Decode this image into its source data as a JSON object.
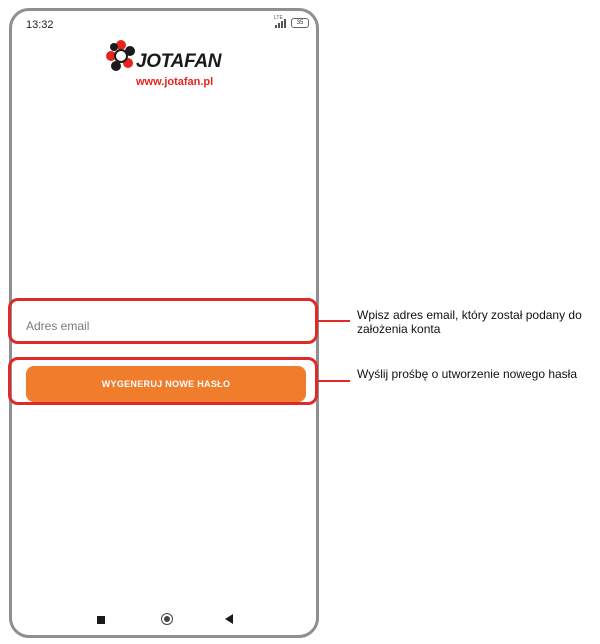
{
  "status_bar": {
    "time": "13:32",
    "network": "LTE",
    "battery": "35"
  },
  "logo": {
    "brand": "JOTAFAN",
    "url": "www.jotafan.pl"
  },
  "email": {
    "placeholder": "Adres email",
    "value": ""
  },
  "submit": {
    "label": "WYGENERUJ NOWE HASŁO"
  },
  "colors": {
    "accent": "#ef7d2c",
    "highlight": "#e02a2a",
    "brand_red": "#e52420"
  },
  "annotations": [
    {
      "text": "Wpisz adres email, który został podany do założenia konta"
    },
    {
      "text": "Wyślij prośbę o utworzenie nowego hasła"
    }
  ],
  "nav": {
    "icons": [
      "recent-apps-icon",
      "home-icon",
      "back-icon"
    ]
  }
}
